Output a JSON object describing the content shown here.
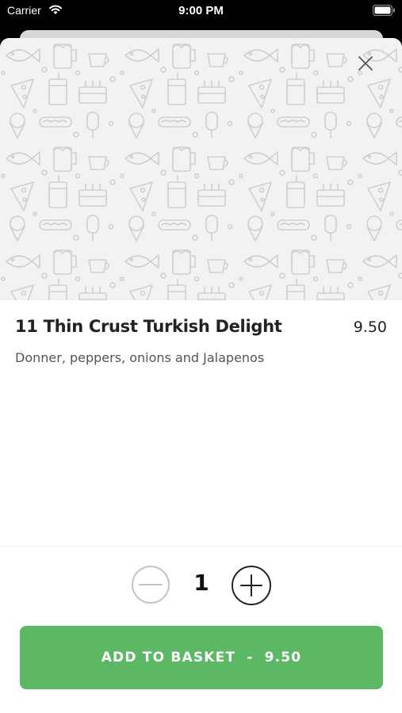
{
  "status_bar": {
    "carrier": "Carrier",
    "time": "9:00 PM"
  },
  "icons": {
    "wifi": "wifi-icon",
    "battery": "battery-icon",
    "close": "close-icon",
    "minus": "minus-icon",
    "plus": "plus-icon",
    "pattern": "food-doodle-pattern"
  },
  "product": {
    "title": "11 Thin Crust Turkish Delight",
    "price": "9.50",
    "description": "Donner, peppers, onions and Jalapenos"
  },
  "quantity": {
    "value": "1"
  },
  "add_button": {
    "label": "ADD TO BASKET",
    "separator": "-",
    "price": "9.50"
  },
  "colors": {
    "accent": "#5cb865",
    "hero_bg": "#f2f2f2",
    "text": "#222222"
  }
}
